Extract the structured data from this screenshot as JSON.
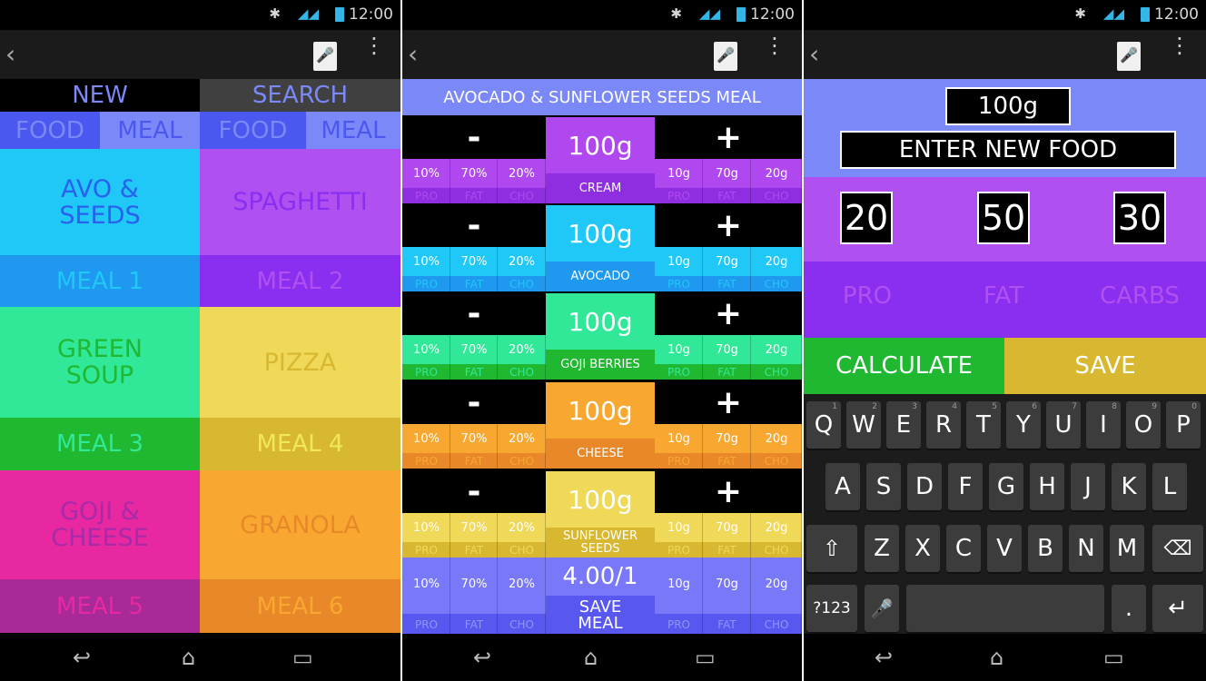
{
  "status": {
    "time": "12:00"
  },
  "screen1": {
    "tabs": {
      "new": "NEW",
      "search": "SEARCH"
    },
    "subtabs": [
      "FOOD",
      "MEAL",
      "FOOD",
      "MEAL"
    ],
    "tiles": [
      {
        "name": "AVO &\nSEEDS",
        "meal": "MEAL 1",
        "top": "#20c8f8",
        "bottom": "#1f98f0",
        "text": "#2860f0",
        "meal_text": "#20c8f8"
      },
      {
        "name": "SPAGHETTI",
        "meal": "MEAL 2",
        "top": "#b050f0",
        "bottom": "#8a2ef0",
        "text": "#8a2ef0",
        "meal_text": "#b050f0"
      },
      {
        "name": "GREEN\nSOUP",
        "meal": "MEAL 3",
        "top": "#30e898",
        "bottom": "#20b830",
        "text": "#20b830",
        "meal_text": "#30e898"
      },
      {
        "name": "PIZZA",
        "meal": "MEAL 4",
        "top": "#f0d858",
        "bottom": "#d8b830",
        "text": "#d8b830",
        "meal_text": "#f0e858"
      },
      {
        "name": "GOJI &\nCHEESE",
        "meal": "MEAL 5",
        "top": "#e828a0",
        "bottom": "#a82a98",
        "text": "#a82aa8",
        "meal_text": "#e828a0"
      },
      {
        "name": "GRANOLA",
        "meal": "MEAL 6",
        "top": "#f8a830",
        "bottom": "#e88828",
        "text": "#e88828",
        "meal_text": "#f8a830"
      }
    ]
  },
  "screen2": {
    "title": "AVOCADO & SUNFLOWER SEEDS MEAL",
    "minus": "-",
    "plus": "+",
    "foods": [
      {
        "weight": "100g",
        "name": "CREAM",
        "top": "#b048f0",
        "dark": "#8e2ee0"
      },
      {
        "weight": "100g",
        "name": "AVOCADO",
        "top": "#20c8f8",
        "dark": "#1f98f0"
      },
      {
        "weight": "100g",
        "name": "GOJI BERRIES",
        "top": "#30e898",
        "dark": "#20b830"
      },
      {
        "weight": "100g",
        "name": "CHEESE",
        "top": "#f8a830",
        "dark": "#e88828"
      },
      {
        "weight": "100g",
        "name": "SUNFLOWER\nSEEDS",
        "top": "#f0d858",
        "dark": "#d8b830"
      }
    ],
    "pct": [
      "10%",
      "70%",
      "20%"
    ],
    "grams": [
      "10g",
      "70g",
      "20g"
    ],
    "macro_labels": [
      "PRO",
      "FAT",
      "CHO"
    ],
    "summary": {
      "ratio": "4.00/1",
      "save": "SAVE\nMEAL",
      "top": "#7878f8",
      "dark": "#5858f0"
    }
  },
  "screen3": {
    "weight": "100g",
    "name_placeholder": "ENTER NEW FOOD",
    "values": [
      "20",
      "50",
      "30"
    ],
    "labels": [
      "PRO",
      "FAT",
      "CARBS"
    ],
    "calculate": "CALCULATE",
    "save": "SAVE",
    "keyboard": {
      "row1": [
        "Q",
        "W",
        "E",
        "R",
        "T",
        "Y",
        "U",
        "I",
        "O",
        "P"
      ],
      "row1_hints": [
        "1",
        "2",
        "3",
        "4",
        "5",
        "6",
        "7",
        "8",
        "9",
        "0"
      ],
      "row2": [
        "A",
        "S",
        "D",
        "F",
        "G",
        "H",
        "J",
        "K",
        "L"
      ],
      "row3": [
        "Z",
        "X",
        "C",
        "V",
        "B",
        "N",
        "M"
      ],
      "symbols": "?123",
      "period": "."
    }
  }
}
